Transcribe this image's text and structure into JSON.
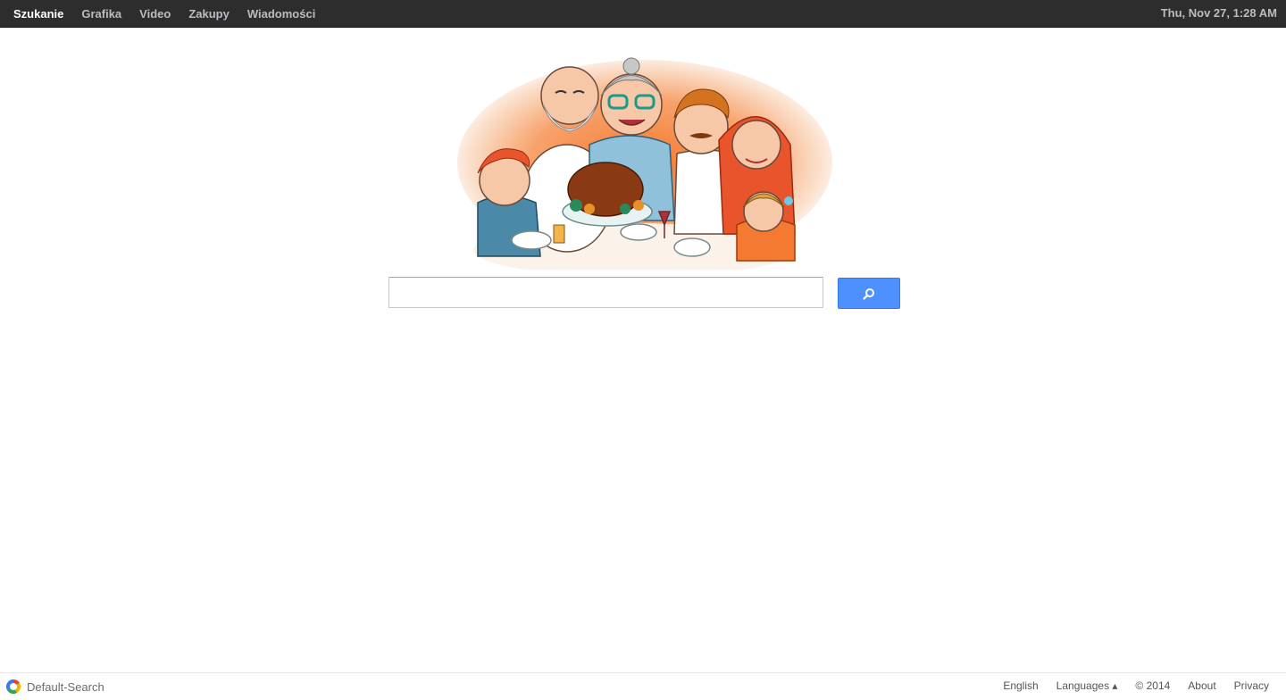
{
  "nav": {
    "items": [
      {
        "label": "Szukanie",
        "active": true
      },
      {
        "label": "Grafika",
        "active": false
      },
      {
        "label": "Video",
        "active": false
      },
      {
        "label": "Zakupy",
        "active": false
      },
      {
        "label": "Wiadomości",
        "active": false
      }
    ]
  },
  "clock": "Thu, Nov 27, 1:28 AM",
  "search": {
    "value": "",
    "placeholder": "",
    "button_icon": "search-icon"
  },
  "doodle": {
    "subject": "thanksgiving-family-doodle",
    "icon": "family-dinner-illustration"
  },
  "footer": {
    "brand": "Default-Search",
    "brand_icon": "default-search-logo-icon",
    "links": {
      "english": "English",
      "languages": "Languages ▴",
      "copyright": "© 2014",
      "about": "About",
      "privacy": "Privacy"
    }
  },
  "colors": {
    "topbar": "#2d2d2d",
    "nav_active": "#ffffff",
    "nav_inactive": "#b9bdc2",
    "search_button": "#4d90fe"
  }
}
